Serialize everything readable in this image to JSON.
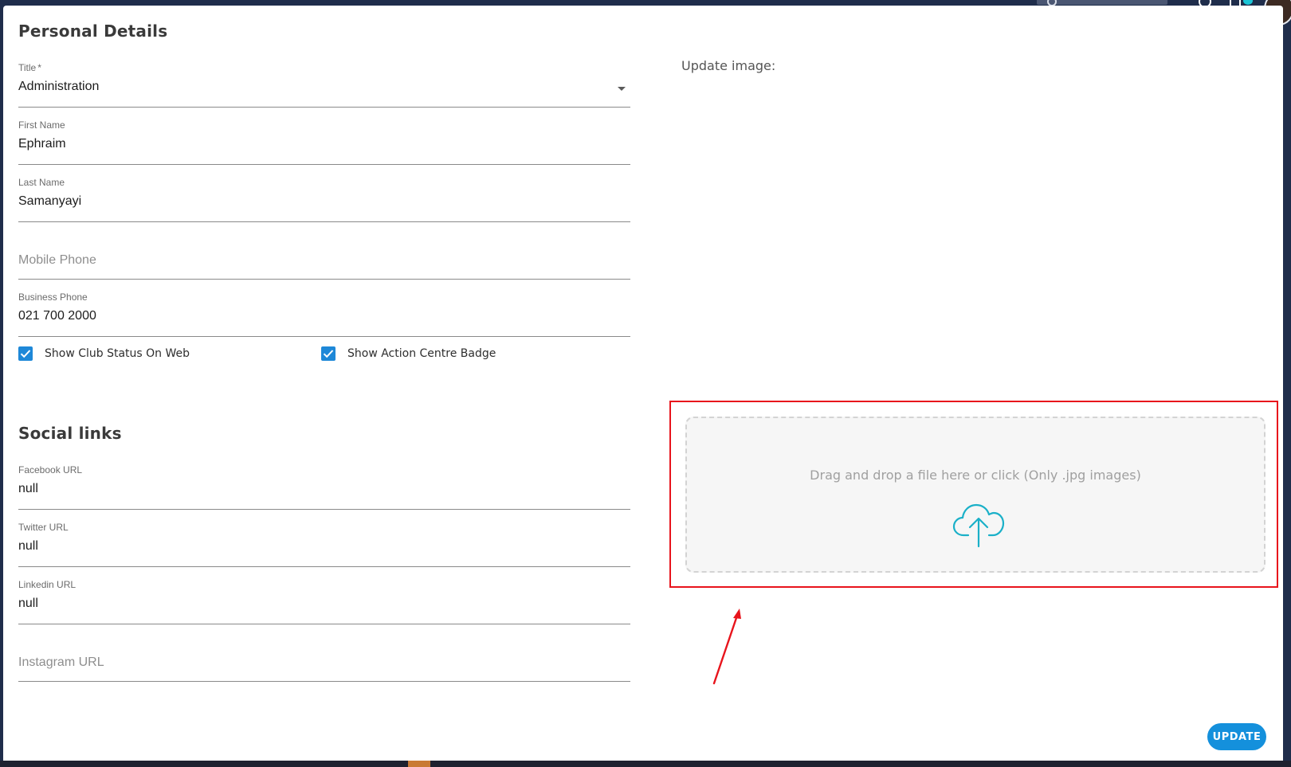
{
  "dialog": {
    "personal_details_title": "Personal Details",
    "social_links_title": "Social links"
  },
  "fields": {
    "title": {
      "label": "Title",
      "required_mark": "*",
      "value": "Administration"
    },
    "first_name": {
      "label": "First Name",
      "value": "Ephraim"
    },
    "last_name": {
      "label": "Last Name",
      "value": "Samanyayi"
    },
    "mobile_phone": {
      "placeholder": "Mobile Phone"
    },
    "business_phone": {
      "label": "Business Phone",
      "value": "021 700 2000"
    },
    "facebook_url": {
      "label": "Facebook URL",
      "value": "null"
    },
    "twitter_url": {
      "label": "Twitter URL",
      "value": "null"
    },
    "linkedin_url": {
      "label": "Linkedin URL",
      "value": "null"
    },
    "instagram_url": {
      "placeholder": "Instagram URL"
    }
  },
  "checkboxes": {
    "show_club_status": {
      "label": "Show Club Status On Web",
      "checked": true
    },
    "show_action_centre_badge": {
      "label": "Show Action Centre Badge",
      "checked": true
    }
  },
  "image_upload": {
    "label": "Update image:",
    "dropzone_text": "Drag and drop a file here or click (Only .jpg images)",
    "icon": "cloud-upload-icon"
  },
  "buttons": {
    "update_label": "UPDATE"
  },
  "colors": {
    "accent": "#1490dc",
    "checkbox": "#1e88d8",
    "upload_icon": "#1ab0c8",
    "annotation": "#e8141c"
  }
}
